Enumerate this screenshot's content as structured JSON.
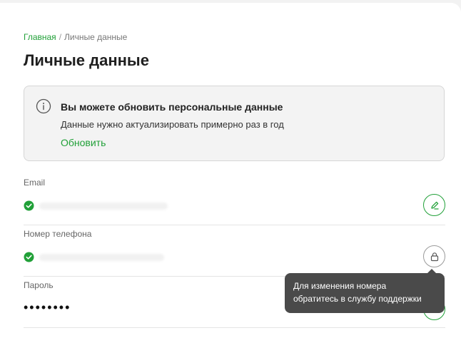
{
  "breadcrumb": {
    "home": "Главная",
    "separator": "/",
    "current": "Личные данные"
  },
  "page": {
    "title": "Личные данные"
  },
  "notice": {
    "icon": "info-icon",
    "title": "Вы можете обновить персональные данные",
    "text": "Данные нужно актуализировать примерно раз в год",
    "action": "Обновить"
  },
  "fields": {
    "email": {
      "label": "Email",
      "status_icon": "check-circle-icon",
      "action_icon": "pencil-icon"
    },
    "phone": {
      "label": "Номер телефона",
      "status_icon": "check-circle-icon",
      "action_icon": "lock-icon"
    },
    "password": {
      "label": "Пароль",
      "value": "••••••••"
    }
  },
  "tooltip": {
    "line1": "Для изменения номера",
    "line2": "обратитесь в службу поддержки"
  },
  "colors": {
    "accent": "#21a038",
    "tooltip_bg": "#4a4a4a",
    "notice_bg": "#f3f3f3"
  }
}
